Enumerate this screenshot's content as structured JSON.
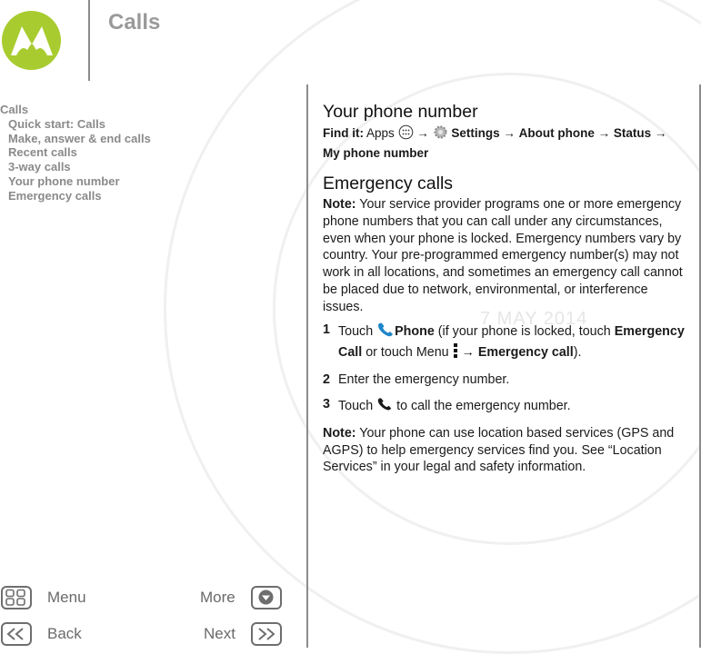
{
  "header": {
    "title": "Calls",
    "logo_color": "#a8cc2f"
  },
  "watermark": {
    "date": "7 MAY 2014"
  },
  "toc": {
    "heading": "Calls",
    "items": [
      {
        "label": "Quick start: Calls"
      },
      {
        "label": "Make, answer & end calls"
      },
      {
        "label": "Recent calls"
      },
      {
        "label": "3-way calls"
      },
      {
        "label": "Your phone number"
      },
      {
        "label": "Emergency calls"
      }
    ]
  },
  "footer": {
    "menu_label": "Menu",
    "more_label": "More",
    "back_label": "Back",
    "next_label": "Next"
  },
  "content": {
    "section1": {
      "heading": "Your phone number",
      "find_it_label": "Find it:",
      "apps": "Apps",
      "arrow": "→",
      "settings": "Settings",
      "about_phone": "About phone",
      "status": "Status",
      "my_phone_number": "My phone number"
    },
    "section2": {
      "heading": "Emergency calls",
      "note_label": "Note:",
      "note_text": " Your service provider programs one or more emergency phone numbers that you can call under any circumstances, even when your phone is locked. Emergency numbers vary by country. Your pre-programmed emergency number(s) may not work in all locations, and sometimes an emergency call cannot be placed due to network, environmental, or interference issues.",
      "steps": [
        {
          "num": "1",
          "touch": "Touch ",
          "phone": "Phone",
          "mid": " (if your phone is locked, touch ",
          "emergency_call_bold": "Emergency Call",
          "or_menu": " or touch Menu ",
          "arrow": " → ",
          "emergency_call2": "Emergency call",
          "end": ")."
        },
        {
          "num": "2",
          "text": "Enter the emergency number."
        },
        {
          "num": "3",
          "touch": "Touch ",
          "text": " to call the emergency number."
        }
      ],
      "note2_label": "Note:",
      "note2_text": " Your phone can use location based services (GPS and AGPS) to help emergency services find you. See “Location Services” in your legal and safety information."
    }
  }
}
